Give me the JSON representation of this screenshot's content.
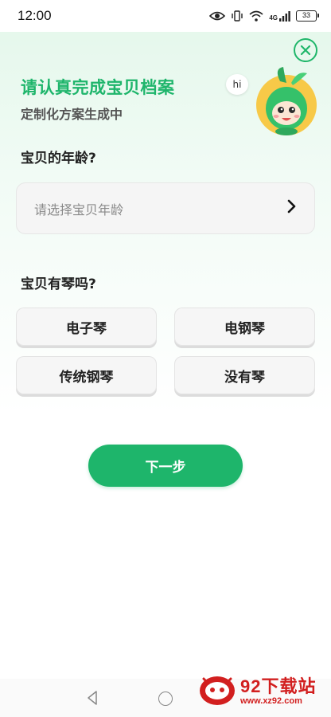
{
  "status_bar": {
    "time": "12:00",
    "network": "4G",
    "battery": "33",
    "icons": [
      "eye-icon",
      "vibrate-icon",
      "wifi-icon",
      "signal-icon",
      "battery-icon"
    ]
  },
  "header": {
    "title": "请认真完成宝贝档案",
    "subtitle": "定制化方案生成中",
    "mascot_bubble": "hi",
    "close_icon": "close-icon"
  },
  "age_section": {
    "label": "宝贝的年龄?",
    "placeholder": "请选择宝贝年龄",
    "chevron": "›"
  },
  "piano_section": {
    "label": "宝贝有琴吗?",
    "options": [
      "电子琴",
      "电钢琴",
      "传统钢琴",
      "没有琴"
    ]
  },
  "next_button": {
    "label": "下一步"
  },
  "navigation": {
    "icons": [
      "back-icon",
      "home-icon"
    ]
  },
  "watermark": {
    "brand": "92下载站",
    "url": "www.xz92.com"
  },
  "colors": {
    "accent": "#1eb56b",
    "background_top": "#e3f7ea",
    "option_bg": "#f6f6f6",
    "watermark_red": "#d21f1f"
  }
}
